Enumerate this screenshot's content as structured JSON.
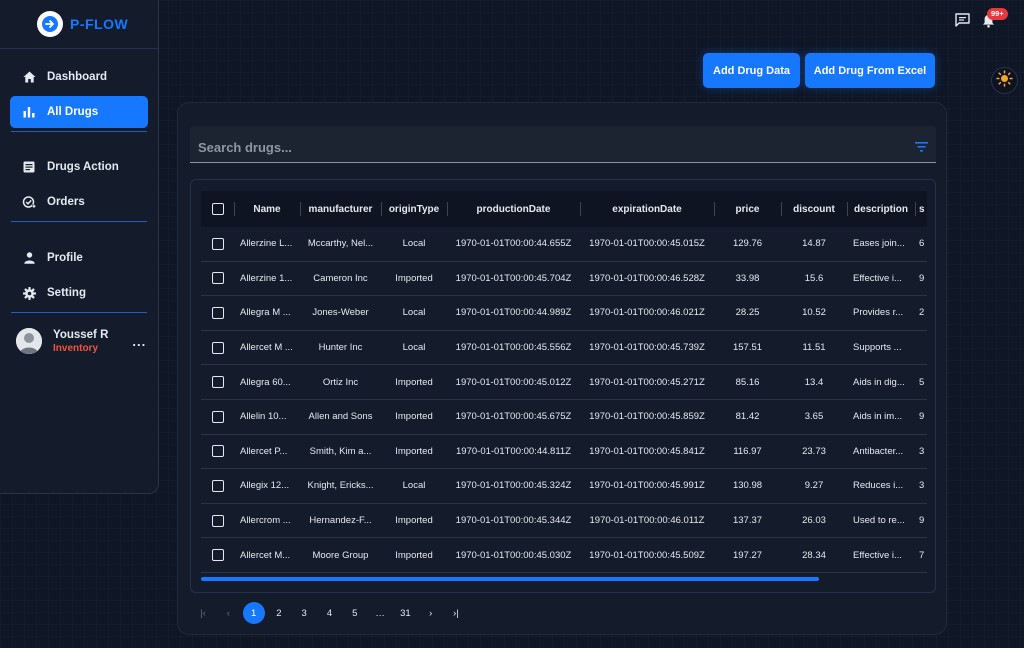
{
  "brand": {
    "name": "P-FLOW"
  },
  "nav": {
    "dashboard": "Dashboard",
    "all_drugs": "All Drugs",
    "drugs_action": "Drugs Action",
    "orders": "Orders",
    "profile": "Profile",
    "setting": "Setting"
  },
  "user": {
    "name": "Youssef R",
    "role": "Inventory",
    "more": "..."
  },
  "notifications": {
    "badge": "99+"
  },
  "actions": {
    "add_drug": "Add Drug Data",
    "add_excel": "Add Drug From Excel"
  },
  "search": {
    "placeholder": "Search drugs..."
  },
  "table": {
    "columns": [
      "Name",
      "manufacturer",
      "originType",
      "productionDate",
      "expirationDate",
      "price",
      "discount",
      "description",
      "s"
    ],
    "rows": [
      [
        "Allerzine L...",
        "Mccarthy, Nel...",
        "Local",
        "1970-01-01T00:00:44.655Z",
        "1970-01-01T00:00:45.015Z",
        "129.76",
        "14.87",
        "Eases join...",
        "6"
      ],
      [
        "Allerzine 1...",
        "Cameron Inc",
        "Imported",
        "1970-01-01T00:00:45.704Z",
        "1970-01-01T00:00:46.528Z",
        "33.98",
        "15.6",
        "Effective i...",
        "9"
      ],
      [
        "Allegra M ...",
        "Jones-Weber",
        "Local",
        "1970-01-01T00:00:44.989Z",
        "1970-01-01T00:00:46.021Z",
        "28.25",
        "10.52",
        "Provides r...",
        "2"
      ],
      [
        "Allercet M ...",
        "Hunter Inc",
        "Local",
        "1970-01-01T00:00:45.556Z",
        "1970-01-01T00:00:45.739Z",
        "157.51",
        "11.51",
        "Supports ...",
        ""
      ],
      [
        "Allegra 60...",
        "Ortiz Inc",
        "Imported",
        "1970-01-01T00:00:45.012Z",
        "1970-01-01T00:00:45.271Z",
        "85.16",
        "13.4",
        "Aids in dig...",
        "5"
      ],
      [
        "Allelin 10...",
        "Allen and Sons",
        "Imported",
        "1970-01-01T00:00:45.675Z",
        "1970-01-01T00:00:45.859Z",
        "81.42",
        "3.65",
        "Aids in im...",
        "9"
      ],
      [
        "Allercet P...",
        "Smith, Kim a...",
        "Imported",
        "1970-01-01T00:00:44.811Z",
        "1970-01-01T00:00:45.841Z",
        "116.97",
        "23.73",
        "Antibacter...",
        "3"
      ],
      [
        "Allegix 12...",
        "Knight, Ericks...",
        "Local",
        "1970-01-01T00:00:45.324Z",
        "1970-01-01T00:00:45.991Z",
        "130.98",
        "9.27",
        "Reduces i...",
        "3"
      ],
      [
        "Allercrom ...",
        "Hernandez-F...",
        "Imported",
        "1970-01-01T00:00:45.344Z",
        "1970-01-01T00:00:46.011Z",
        "137.37",
        "26.03",
        "Used to re...",
        "9"
      ],
      [
        "Allercet M...",
        "Moore Group",
        "Imported",
        "1970-01-01T00:00:45.030Z",
        "1970-01-01T00:00:45.509Z",
        "197.27",
        "28.34",
        "Effective i...",
        "7"
      ]
    ]
  },
  "pagination": {
    "first": "|‹",
    "prev": "‹",
    "pages": [
      "1",
      "2",
      "3",
      "4",
      "5",
      "…",
      "31"
    ],
    "current": "1",
    "next": "›",
    "last": "›|"
  },
  "colors": {
    "accent": "#1677ff",
    "role": "#f0533f",
    "badge": "#e8383d",
    "sun": "#f5a524"
  },
  "icons": [
    "logo-icon",
    "home-icon",
    "bar-chart-icon",
    "list-icon",
    "orders-icon",
    "user-icon",
    "gear-icon",
    "chat-icon",
    "bell-icon",
    "sun-icon",
    "filter-icon"
  ]
}
